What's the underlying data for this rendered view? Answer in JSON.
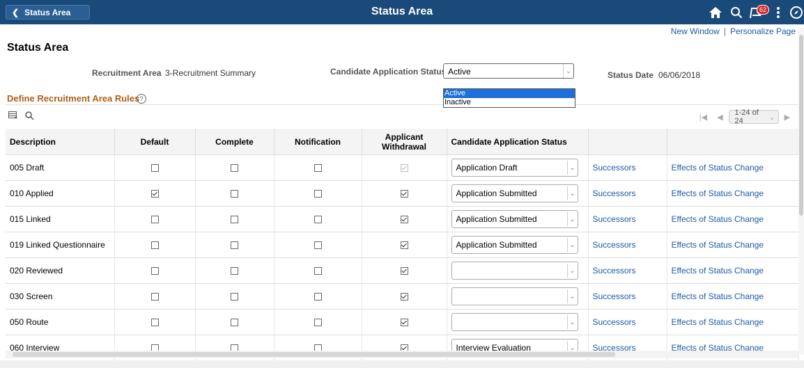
{
  "header": {
    "back_label": "Status Area",
    "title": "Status Area",
    "notification_count": "62",
    "icons": [
      "home-icon",
      "search-icon",
      "flag-icon",
      "more-icon",
      "navbar-icon"
    ]
  },
  "links": {
    "new_window": "New Window",
    "separator": "|",
    "personalize": "Personalize Page"
  },
  "page_title": "Status Area",
  "form": {
    "recruitment_area_label": "Recruitment Area",
    "recruitment_area_value": "3-Recruitment Summary",
    "cand_status_label": "Candidate Application Status",
    "cand_status_value": "Active",
    "cand_status_options": [
      "Active",
      "Inactive"
    ],
    "status_date_label": "Status Date",
    "status_date_value": "06/06/2018"
  },
  "section_title": "Define Recruitment Area Rules",
  "pager": {
    "count": "1-24 of 24"
  },
  "table": {
    "columns": [
      "Description",
      "Default",
      "Complete",
      "Notification",
      "Applicant Withdrawal",
      "Candidate Application Status",
      "",
      ""
    ],
    "rows": [
      {
        "desc": "005 Draft",
        "default": false,
        "complete": false,
        "notification": false,
        "withdrawal": true,
        "withdrawal_disabled": true,
        "status": "Application Draft",
        "successors": "Successors",
        "effects": "Effects of Status Change"
      },
      {
        "desc": "010 Applied",
        "default": true,
        "complete": false,
        "notification": false,
        "withdrawal": true,
        "withdrawal_disabled": false,
        "status": "Application Submitted",
        "successors": "Successors",
        "effects": "Effects of Status Change"
      },
      {
        "desc": "015 Linked",
        "default": false,
        "complete": false,
        "notification": false,
        "withdrawal": true,
        "withdrawal_disabled": false,
        "status": "Application Submitted",
        "successors": "Successors",
        "effects": "Effects of Status Change"
      },
      {
        "desc": "019 Linked Questionnaire",
        "default": false,
        "complete": false,
        "notification": false,
        "withdrawal": true,
        "withdrawal_disabled": false,
        "status": "Application Submitted",
        "successors": "Successors",
        "effects": "Effects of Status Change"
      },
      {
        "desc": "020 Reviewed",
        "default": false,
        "complete": false,
        "notification": false,
        "withdrawal": true,
        "withdrawal_disabled": false,
        "status": "",
        "successors": "Successors",
        "effects": "Effects of Status Change"
      },
      {
        "desc": "030 Screen",
        "default": false,
        "complete": false,
        "notification": false,
        "withdrawal": true,
        "withdrawal_disabled": false,
        "status": "",
        "successors": "Successors",
        "effects": "Effects of Status Change"
      },
      {
        "desc": "050 Route",
        "default": false,
        "complete": false,
        "notification": false,
        "withdrawal": true,
        "withdrawal_disabled": false,
        "status": "",
        "successors": "Successors",
        "effects": "Effects of Status Change"
      },
      {
        "desc": "060 Interview",
        "default": false,
        "complete": false,
        "notification": false,
        "withdrawal": true,
        "withdrawal_disabled": false,
        "status": "Interview Evaluation",
        "successors": "Successors",
        "effects": "Effects of Status Change"
      }
    ]
  }
}
